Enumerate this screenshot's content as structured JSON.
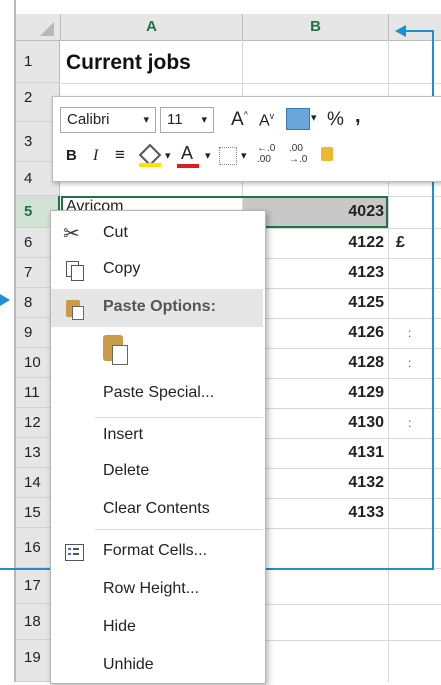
{
  "columns": [
    "A",
    "B"
  ],
  "rows": [
    "1",
    "2",
    "3",
    "4",
    "5",
    "6",
    "7",
    "8",
    "9",
    "10",
    "11",
    "12",
    "13",
    "14",
    "15",
    "16",
    "17",
    "18",
    "19"
  ],
  "cells": {
    "a1": "Current jobs",
    "a5": "Avricom",
    "b_values": [
      "4023",
      "4122",
      "4123",
      "4125",
      "4126",
      "4128",
      "4129",
      "4130",
      "4131",
      "4132",
      "4133"
    ],
    "c6": "£"
  },
  "mini_toolbar": {
    "font": "Calibri",
    "size": "11",
    "grow_label": "A",
    "shrink_label": "A",
    "percent": "%",
    "comma": ",",
    "bold": "B",
    "italic": "I",
    "font_color_label": "A",
    "inc_decimal": "←.0 .00",
    "dec_decimal": ".00 →.0"
  },
  "context_menu": {
    "items": [
      {
        "label": "Cut",
        "icon": "scissors-icon"
      },
      {
        "label": "Copy",
        "icon": "copy-icon"
      },
      {
        "label": "Paste Options:",
        "icon": "paste-icon"
      },
      {
        "label": "Paste Special...",
        "icon": ""
      },
      {
        "label": "Insert",
        "icon": ""
      },
      {
        "label": "Delete",
        "icon": ""
      },
      {
        "label": "Clear Contents",
        "icon": ""
      },
      {
        "label": "Format Cells...",
        "icon": "format-cells-icon"
      },
      {
        "label": "Row Height...",
        "icon": ""
      },
      {
        "label": "Hide",
        "icon": ""
      },
      {
        "label": "Unhide",
        "icon": ""
      }
    ]
  },
  "colors": {
    "excel_green": "#217346",
    "callout_blue": "#1f8fd0",
    "highlight_gray": "#e6e6e6"
  }
}
